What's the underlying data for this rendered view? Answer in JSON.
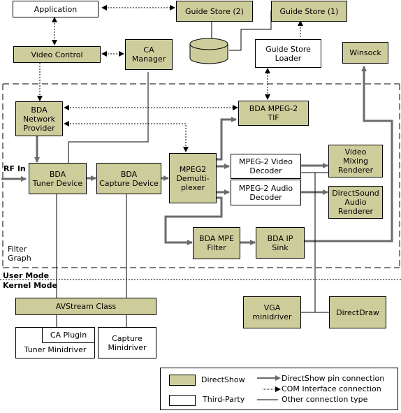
{
  "diagram": {
    "components": {
      "application": "Application",
      "guide_store_2": "Guide Store (2)",
      "guide_store_1": "Guide Store (1)",
      "video_control": "Video Control",
      "ca_manager": "CA\nManager",
      "guide_store_loader": "Guide Store\nLoader",
      "winsock": "Winsock",
      "bda_network_provider": "BDA\nNetwork\nProvider",
      "bda_mpeg2_tif": "BDA MPEG-2\nTIF",
      "bda_tuner_device": "BDA\nTuner Device",
      "bda_capture_device": "BDA\nCapture Device",
      "mpeg2_demux": "MPEG2\nDemulti-\nplexer",
      "mpeg2_video_decoder": "MPEG-2 Video\nDecoder",
      "mpeg2_audio_decoder": "MPEG-2 Audio\nDecoder",
      "video_mixing_renderer": "Video\nMixing\nRenderer",
      "directsound_audio_renderer": "DirectSound\nAudio\nRenderer",
      "bda_mpe_filter": "BDA MPE\nFilter",
      "bda_ip_sink": "BDA IP\nSink",
      "avstream_class": "AVStream Class",
      "ca_plugin": "CA Plugin",
      "tuner_minidriver": "Tuner Minidriver",
      "capture_minidriver": "Capture\nMinidriver",
      "vga_minidriver": "VGA\nminidriver",
      "directdraw": "DirectDraw"
    },
    "labels": {
      "rf_in": "RF In",
      "filter_graph": "Filter\nGraph",
      "user_mode": "User Mode",
      "kernel_mode": "Kernel Mode"
    },
    "legend": {
      "directshow": "DirectShow",
      "third_party": "Third-Party",
      "pin_connection": "DirectShow pin connection",
      "com_connection": "COM Interface connection",
      "other_connection": "Other connection type"
    },
    "colors": {
      "directshow_fill": "#cdcd9c",
      "third_party_fill": "#ffffff",
      "pin_connection": "#6b6b6b",
      "line": "#000000"
    }
  }
}
